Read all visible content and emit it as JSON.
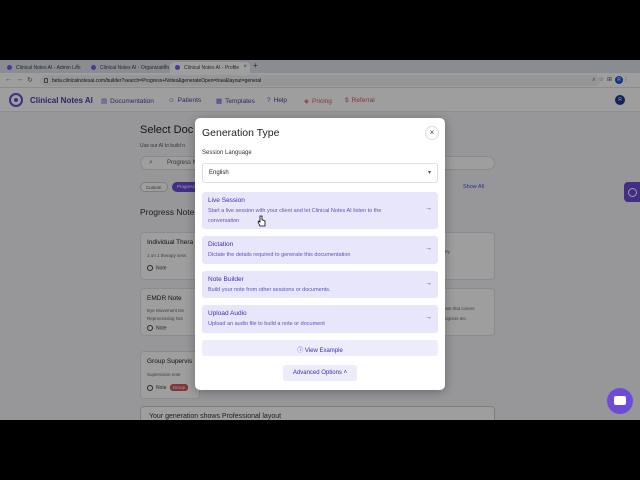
{
  "browser": {
    "tabs": [
      {
        "title": "Clinical Notes AI - Admin Loo"
      },
      {
        "title": "Clinical Notes AI - Organization"
      },
      {
        "title": "Clinical Notes AI - Profile"
      }
    ],
    "url": "beta.clinicalnotesai.com/builder?search=Progress+Notes&generateOpen=true&layout=general"
  },
  "appnav": {
    "brand": "Clinical Notes AI",
    "items": [
      {
        "label": "Documentation",
        "icon": "document-icon"
      },
      {
        "label": "Patients",
        "icon": "users-icon"
      },
      {
        "label": "Templates",
        "icon": "template-icon"
      },
      {
        "label": "Help",
        "icon": "help-icon"
      },
      {
        "label": "Pricing",
        "icon": "tag-icon"
      },
      {
        "label": "Referral",
        "icon": "dollar-icon"
      }
    ],
    "user_initial": "R"
  },
  "background": {
    "title": "Select Doc",
    "subtitle": "Use our AI to build n",
    "search_value": "Progress N",
    "chips": [
      "Custom",
      "Progress"
    ],
    "show_all": "Show All",
    "section_title": "Progress Note",
    "cards": [
      {
        "title": "Individual Thera",
        "desc": "1 on 1 therapy sess",
        "tag": "Note"
      },
      {
        "title": "EMDR Note",
        "desc": "Eye Movement De",
        "desc2": "Reprocessing Not",
        "tag": "Note"
      },
      {
        "title": "Group Supervis",
        "desc": "Supervision note",
        "tag": "Note",
        "badge": "Group"
      }
    ],
    "right_snippets": [
      "ey.",
      "ate that covers",
      "ogress etc."
    ],
    "bottom_text": "Your generation shows Professional layout"
  },
  "modal": {
    "title": "Generation Type",
    "close_label": "×",
    "language_label": "Session Language",
    "language_value": "English",
    "options": [
      {
        "title": "Live Session",
        "desc": "Start a live session with your client and let Clinical Notes AI listen to the conversation"
      },
      {
        "title": "Dictation",
        "desc": "Dictate the details required to generate this documentation"
      },
      {
        "title": "Note Builder",
        "desc": "Build your note from other sessions or documents."
      },
      {
        "title": "Upload Audio",
        "desc": "Upload an audio file to build a note or document"
      }
    ],
    "view_example": "View Example",
    "advanced_options": "Advanced Options"
  },
  "colors": {
    "accent": "#6d4bd8",
    "option_bg": "#e8e6fb",
    "option_text": "#3b2fb0",
    "pricing": "#d05a5a"
  }
}
